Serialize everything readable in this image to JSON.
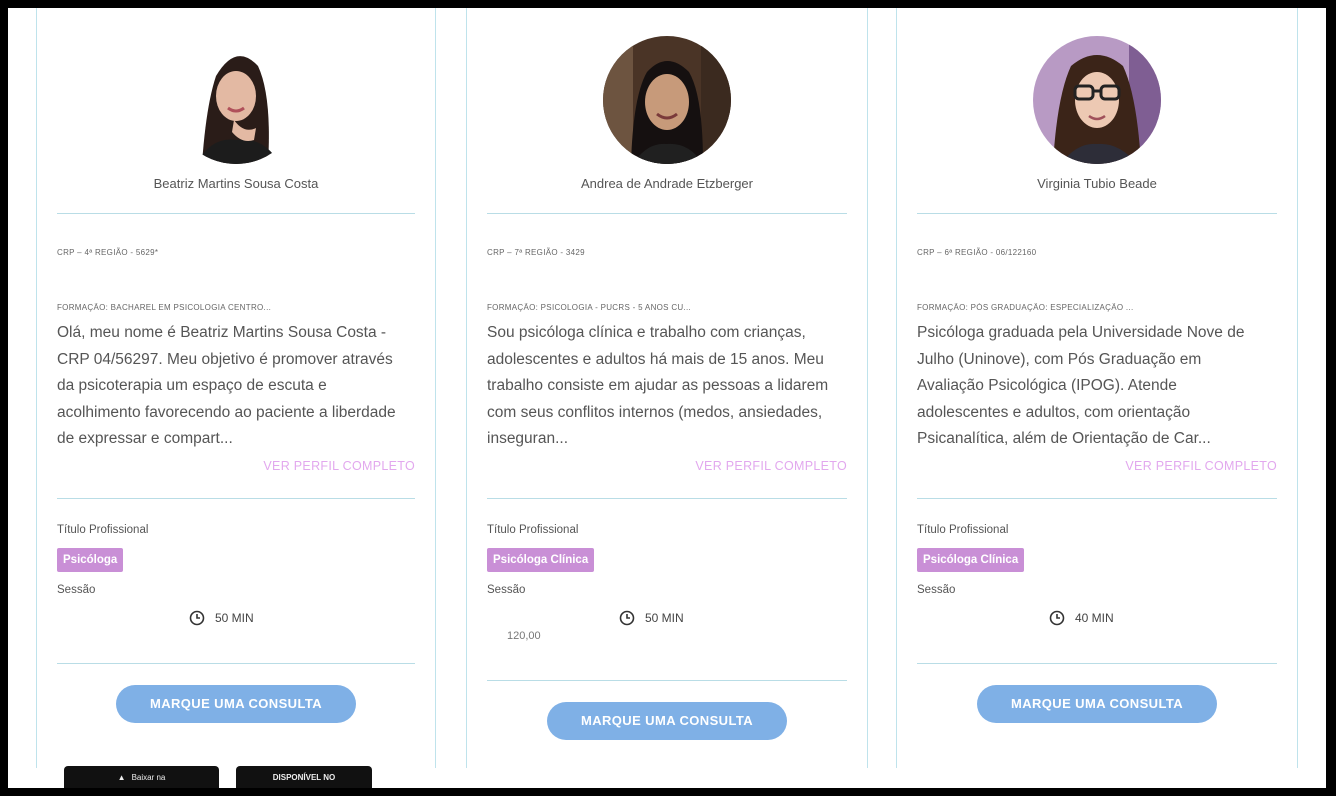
{
  "cards": [
    {
      "name": "Beatriz Martins Sousa Costa",
      "crp": "CRP – 4ª REGIÃO - 5629*",
      "formacao": "FORMAÇÃO: BACHAREL EM PSICOLOGIA CENTRO...",
      "bio": "Olá, meu nome é Beatriz Martins Sousa Costa - CRP 04/56297. Meu objetivo é promover através da psicoterapia um espaço de escuta e acolhimento favorecendo ao paciente a liberdade de expressar e compart...",
      "ver_perfil": "VER PERFIL COMPLETO",
      "titulo_label": "Título Profissional",
      "badge": "Psicóloga",
      "sessao_label": "Sessão",
      "duration": "50 MIN",
      "price": "",
      "cta": "MARQUE UMA CONSULTA"
    },
    {
      "name": "Andrea de Andrade Etzberger",
      "crp": "CRP – 7ª REGIÃO - 3429",
      "formacao": "FORMAÇÃO: PSICOLOGIA - PUCRS - 5 ANOS CU...",
      "bio": "Sou psicóloga clínica e trabalho com crianças, adolescentes e adultos há mais de 15 anos. Meu trabalho consiste em ajudar as pessoas a lidarem com seus conflitos internos (medos, ansiedades, inseguran...",
      "ver_perfil": "VER PERFIL COMPLETO",
      "titulo_label": "Título Profissional",
      "badge": "Psicóloga Clínica",
      "sessao_label": "Sessão",
      "duration": "50 MIN",
      "price": "120,00",
      "cta": "MARQUE UMA CONSULTA"
    },
    {
      "name": "Virginia Tubio Beade",
      "crp": "CRP – 6ª REGIÃO - 06/122160",
      "formacao": "FORMAÇÃO: PÓS GRADUAÇÃO: ESPECIALIZAÇÃO ...",
      "bio": "Psicóloga graduada pela Universidade Nove de Julho (Uninove), com Pós Graduação em Avaliação Psicológica (IPOG). Atende adolescentes e adultos, com orientação Psicanalítica, além de Orientação de Car...",
      "ver_perfil": "VER PERFIL COMPLETO",
      "titulo_label": "Título Profissional",
      "badge": "Psicóloga Clínica",
      "sessao_label": "Sessão",
      "duration": "40 MIN",
      "price": "",
      "cta": "MARQUE UMA CONSULTA"
    }
  ],
  "footer": {
    "store1": "Baixar na",
    "store2": "DISPONÍVEL NO"
  },
  "colors": {
    "accent_button": "#7fb0e6",
    "badge": "#c98fd6",
    "link": "#e2a8ee",
    "divider": "#b9dde6"
  }
}
